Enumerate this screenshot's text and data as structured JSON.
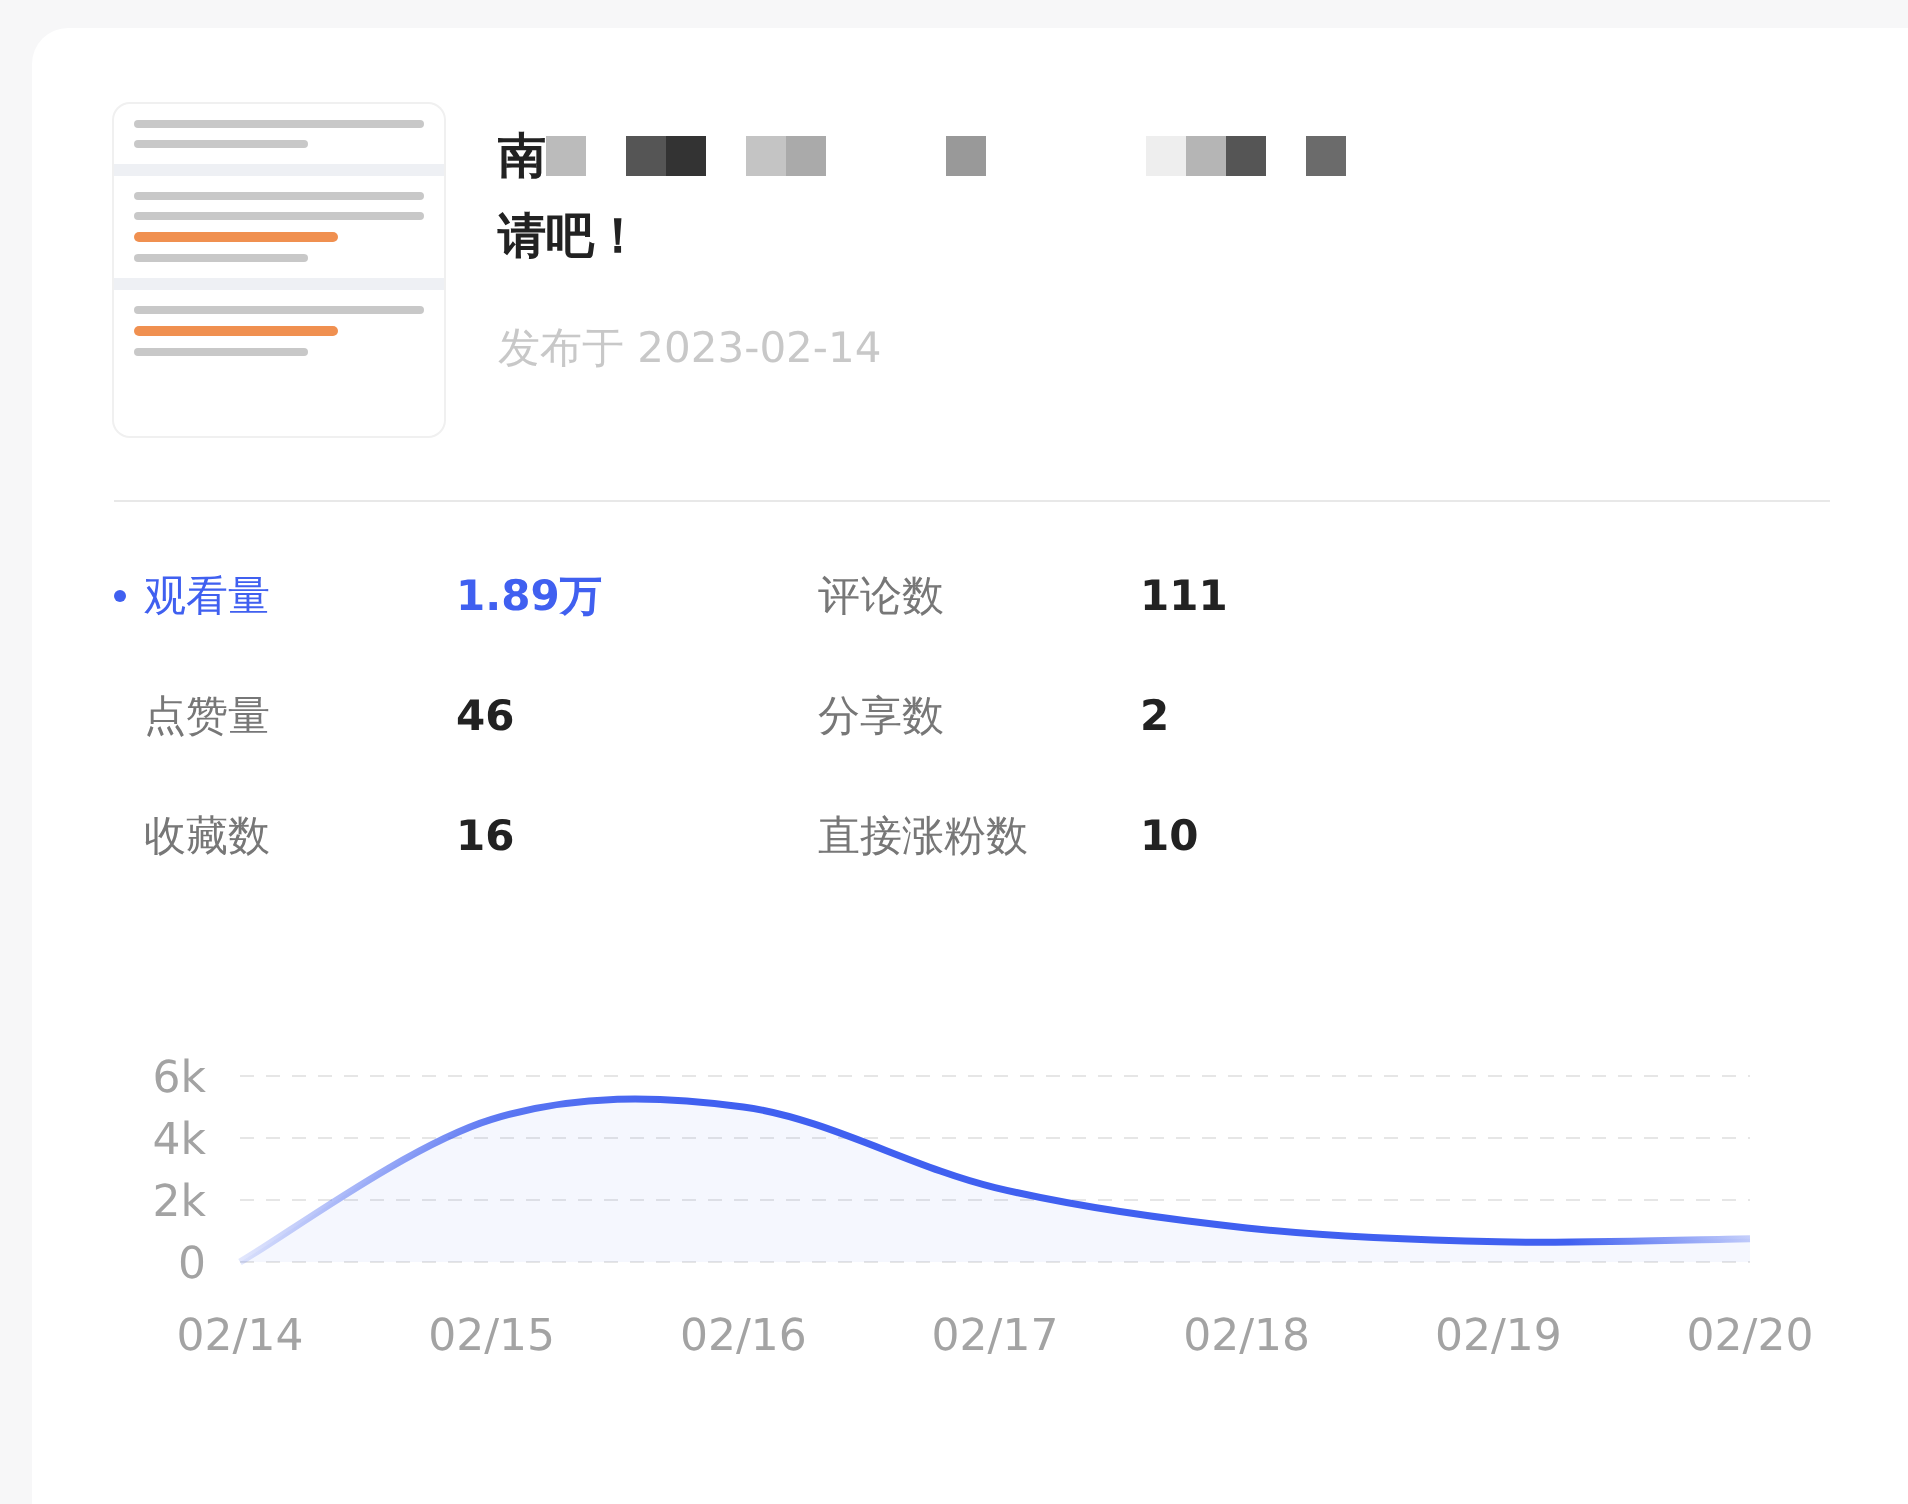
{
  "video": {
    "title_lines": [
      "南",
      "请吧！"
    ],
    "published": "发布于 2023-02-14"
  },
  "stats": [
    {
      "label": "观看量",
      "value": "1.89万",
      "selected": true
    },
    {
      "label": "评论数",
      "value": "111",
      "selected": false
    },
    {
      "label": "点赞量",
      "value": "46",
      "selected": false
    },
    {
      "label": "分享数",
      "value": "2",
      "selected": false
    },
    {
      "label": "收藏数",
      "value": "16",
      "selected": false
    },
    {
      "label": "直接涨粉数",
      "value": "10",
      "selected": false
    }
  ],
  "chart": {
    "chart_data": {
      "type": "area",
      "categories": [
        "02/14",
        "02/15",
        "02/16",
        "02/17",
        "02/18",
        "02/19",
        "02/20"
      ],
      "series": [
        {
          "color": "#4060f0",
          "values": [
            0,
            4600,
            5000,
            2400,
            1100,
            650,
            750
          ]
        }
      ],
      "ylim": [
        0,
        6000
      ],
      "yticks": [
        {
          "value": 0,
          "label": "0"
        },
        {
          "value": 2000,
          "label": "2k"
        },
        {
          "value": 4000,
          "label": "4k"
        },
        {
          "value": 6000,
          "label": "6k"
        }
      ]
    }
  }
}
